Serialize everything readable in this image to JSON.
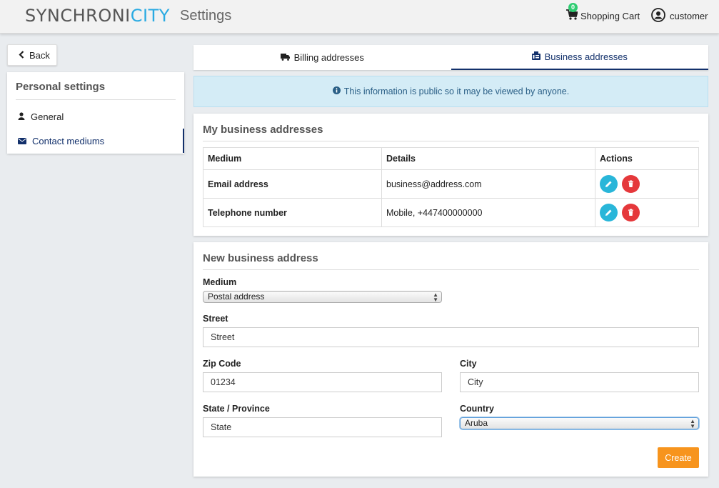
{
  "header": {
    "brand_part1": "SYNCHRONI",
    "brand_part2": "CITY",
    "page_title": "Settings",
    "cart_label": "Shopping Cart",
    "cart_count": "0",
    "user_label": "customer"
  },
  "sidebar": {
    "back_label": "Back",
    "title": "Personal settings",
    "items": [
      {
        "label": "General",
        "icon": "user-icon"
      },
      {
        "label": "Contact mediums",
        "icon": "envelope-icon",
        "active": true
      }
    ]
  },
  "tabs": [
    {
      "label": "Billing addresses",
      "icon": "truck-icon"
    },
    {
      "label": "Business addresses",
      "icon": "fax-icon",
      "active": true
    }
  ],
  "alert": {
    "text": "This information is public so it may be viewed by anyone."
  },
  "addresses": {
    "title": "My business addresses",
    "columns": [
      "Medium",
      "Details",
      "Actions"
    ],
    "rows": [
      {
        "medium": "Email address",
        "details": "business@address.com"
      },
      {
        "medium": "Telephone number",
        "details": "Mobile, +447400000000"
      }
    ]
  },
  "form": {
    "title": "New business address",
    "medium_label": "Medium",
    "medium_value": "Postal address",
    "street_label": "Street",
    "street_placeholder": "Street",
    "zip_label": "Zip Code",
    "zip_placeholder": "01234",
    "city_label": "City",
    "city_placeholder": "City",
    "state_label": "State / Province",
    "state_placeholder": "State",
    "country_label": "Country",
    "country_value": "Aruba",
    "create_label": "Create"
  },
  "colors": {
    "brand_accent": "#29aae2",
    "primary_navy": "#12306b",
    "create_button": "#f7941d",
    "edit_button": "#29b6d9",
    "delete_button": "#e5383b",
    "cart_badge": "#2ecc71",
    "alert_bg": "#d4ecf6"
  }
}
